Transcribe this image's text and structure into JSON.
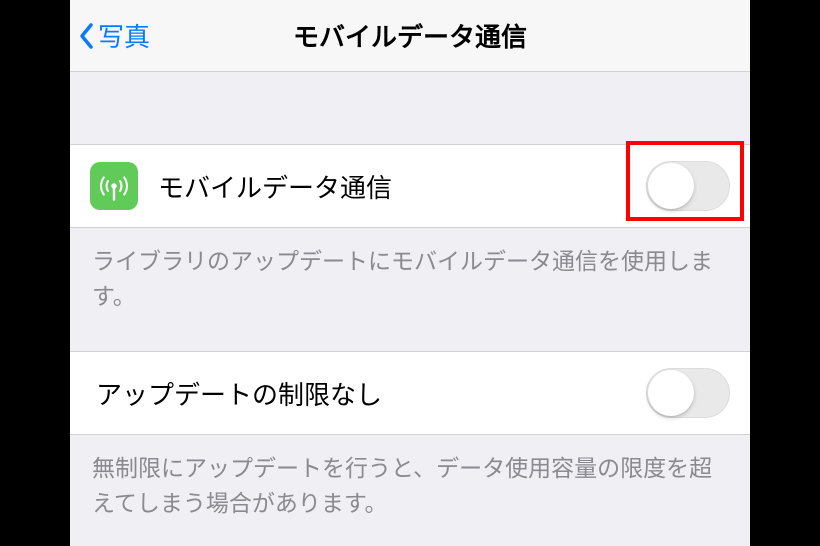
{
  "navbar": {
    "back_label": "写真",
    "title": "モバイルデータ通信"
  },
  "section1": {
    "row_label": "モバイルデータ通信",
    "icon_name": "cellular-signal-icon",
    "toggle_on": false,
    "footer": "ライブラリのアップデートにモバイルデータ通信を使用します。",
    "highlighted": true
  },
  "section2": {
    "row_label": "アップデートの制限なし",
    "toggle_on": false,
    "footer": "無制限にアップデートを行うと、データ使用容量の限度を超えてしまう場合があります。"
  },
  "colors": {
    "accent": "#0a7aff",
    "icon_bg": "#60cb58",
    "highlight": "#ff0000"
  }
}
